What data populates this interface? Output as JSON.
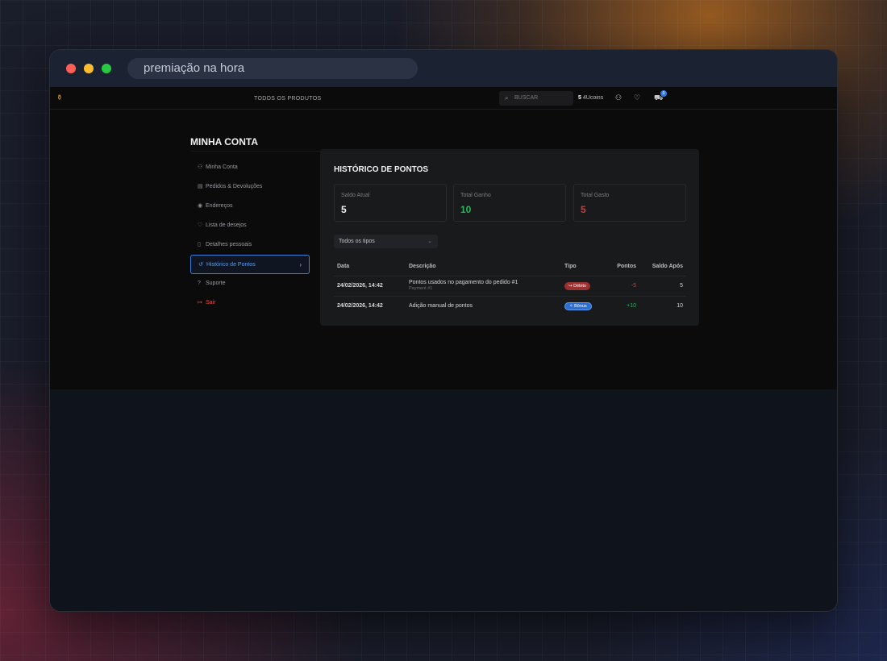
{
  "browser": {
    "url_text": "premiação na hora"
  },
  "topnav": {
    "logo": "⚱",
    "products_link": "TODOS OS PRODUTOS",
    "search_placeholder": "BUSCAR",
    "coins_count": "5",
    "coins_label": "4Ucoins",
    "cart_count": "0"
  },
  "page": {
    "title": "MINHA CONTA"
  },
  "sidebar": {
    "items": [
      {
        "label": "Minha Conta",
        "icon": "user-icon"
      },
      {
        "label": "Pedidos & Devoluções",
        "icon": "orders-icon"
      },
      {
        "label": "Endereços",
        "icon": "location-icon"
      },
      {
        "label": "Lista de desejos",
        "icon": "heart-icon"
      },
      {
        "label": "Detalhes pessoais",
        "icon": "document-icon"
      },
      {
        "label": "Histórico de Pontos",
        "icon": "history-icon"
      },
      {
        "label": "Suporte",
        "icon": "help-icon"
      },
      {
        "label": "Sair",
        "icon": "logout-icon"
      }
    ],
    "active_index": 5
  },
  "points": {
    "title": "HISTÓRICO DE PONTOS",
    "stats": [
      {
        "label": "Saldo Atual",
        "value": "5",
        "color": "#f2f2f4"
      },
      {
        "label": "Total Ganho",
        "value": "10",
        "color": "#2bb65a"
      },
      {
        "label": "Total Gasto",
        "value": "5",
        "color": "#d43b3b"
      }
    ],
    "filter_value": "Todos os tipos",
    "columns": {
      "date": "Data",
      "description": "Descrição",
      "type": "Tipo",
      "points": "Pontos",
      "balance_after": "Saldo Após"
    },
    "rows": [
      {
        "date": "24/02/2026, 14:42",
        "description": "Pontos usados no pagamento do pedido #1",
        "sub": "Payment #1",
        "type": "Débito",
        "points": "-5",
        "balance_after": "5"
      },
      {
        "date": "24/02/2026, 14:42",
        "description": "Adição manual de pontos",
        "sub": "",
        "type": "Bônus",
        "points": "+10",
        "balance_after": "10"
      }
    ]
  }
}
